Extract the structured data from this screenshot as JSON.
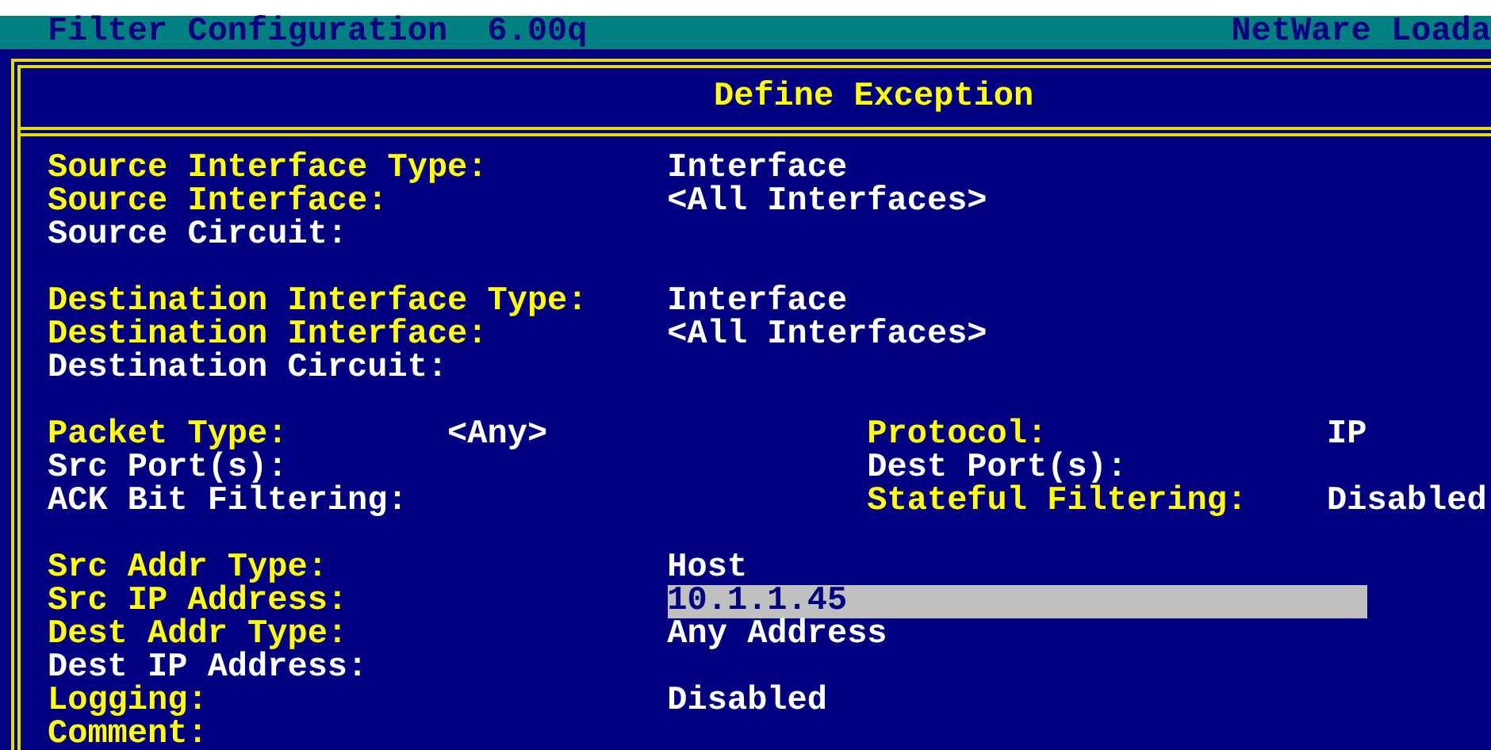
{
  "title_bar": {
    "title": "Filter Configuration  6.00q",
    "product": "NetWare Loada"
  },
  "dialog": {
    "title": "Define Exception"
  },
  "sections": [
    {
      "columns": [
        [
          {
            "label": "Source Interface Type:",
            "value": "Interface",
            "editable": true,
            "selected": false
          },
          {
            "label": "Source Interface:",
            "value": "<All Interfaces>",
            "editable": true,
            "selected": false
          },
          {
            "label": "Source Circuit:",
            "editable": false,
            "selected": false
          }
        ]
      ]
    },
    {
      "columns": [
        [
          {
            "label": "Destination Interface Type:",
            "value": "Interface",
            "editable": true,
            "selected": false
          },
          {
            "label": "Destination Interface:",
            "value": "<All Interfaces>",
            "editable": true,
            "selected": false
          },
          {
            "label": "Destination Circuit:",
            "editable": false,
            "selected": false
          }
        ]
      ]
    },
    {
      "columns": [
        [
          {
            "label": "Packet Type:",
            "value": "<Any>",
            "editable": true,
            "selected": false
          },
          {
            "label": "Src Port(s):",
            "editable": false,
            "selected": false
          },
          {
            "label": "ACK Bit Filtering:",
            "editable": false,
            "selected": false
          }
        ],
        [
          {
            "label": "Protocol:",
            "value": "IP",
            "editable": true,
            "selected": false
          },
          {
            "label": "Dest Port(s):",
            "editable": false,
            "selected": false
          },
          {
            "label": "Stateful Filtering:",
            "value": "Disabled",
            "editable": true,
            "selected": false
          }
        ]
      ]
    },
    {
      "columns": [
        [
          {
            "label": "Src Addr Type:",
            "value": "Host",
            "editable": true,
            "selected": false
          },
          {
            "label": "Src IP Address:",
            "value": "10.1.1.45",
            "editable": true,
            "selected": true
          },
          {
            "label": "Dest Addr Type:",
            "value": "Any Address",
            "editable": true,
            "selected": false
          },
          {
            "label": "Dest IP Address:",
            "editable": false,
            "selected": false
          },
          {
            "label": "Logging:",
            "value": "Disabled",
            "editable": true,
            "selected": false
          },
          {
            "label": "Comment:",
            "editable": true,
            "selected": false
          }
        ]
      ]
    }
  ]
}
